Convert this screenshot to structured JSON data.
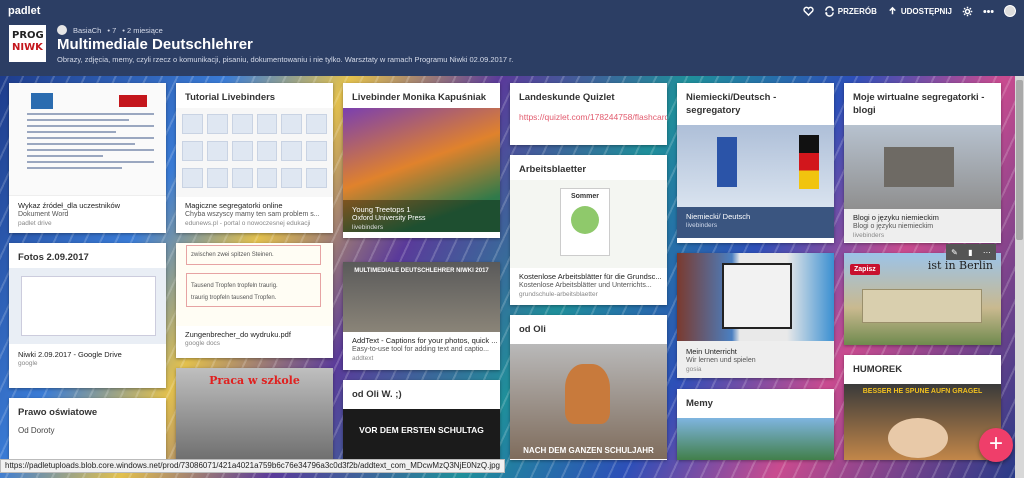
{
  "app": {
    "brand": "padlet"
  },
  "top_actions": {
    "remake": "PRZERÓB",
    "share": "UDOSTĘPNIJ"
  },
  "header": {
    "logo_line1": "PROG",
    "logo_line2": "NIWK",
    "author": "BasiaCh",
    "likes": "• 7",
    "age": "•   2 miesiące",
    "title": "Multimediale Deutschlehrer",
    "subtitle": "Obrazy, zdjęcia, memy, czyli rzecz o komunikacji, pisaniu, dokumentowaniu i nie tylko. Warsztaty w ramach Programu Niwki 02.09.2017 r."
  },
  "cards": {
    "c1": {
      "att_title": "Wykaz źródeł_dla uczestników",
      "att_sub": "Dokument Word",
      "att_src": "padlet drive"
    },
    "c2": {
      "title": "Fotos 2.09.2017",
      "att_title": "Niwki 2.09.2017 - Google Drive",
      "att_src": "google"
    },
    "c3": {
      "title": "Prawo oświatowe",
      "text": "Od Doroty"
    },
    "c4": {
      "title": "Tutorial Livebinders",
      "att_title": "Magiczne segregatorki online",
      "att_sub": "Chyba wszyscy mamy ten sam problem s...",
      "att_src": "edunews.pl - portal o nowoczesnej edukacji"
    },
    "c5": {
      "att_title": "Zungenbrecher_do wydruku.pdf",
      "att_src": "google docs",
      "thumb_line1": "zwischen zwei spitzen Steinen.",
      "thumb_line2": "Tausend Tropfen tropfeln traurig.",
      "thumb_line3": "traurig tropfeln tausend Tropfen."
    },
    "c6": {
      "thumb_text": "Praca w szkole"
    },
    "c7": {
      "title": "Livebinder Monika Kapuśniak",
      "att_title": "Young Treetops 1",
      "att_sub": "Oxford University Press",
      "att_src": "livebinders"
    },
    "c8": {
      "thumb_text": "MULTIMEDIALE DEUTSCHLEHRER NIWKI 2017",
      "att_title": "AddText - Captions for your photos, quick ...",
      "att_sub": "Easy-to-use tool for adding text and captio...",
      "att_src": "addtext"
    },
    "c9": {
      "title": "od Oli  W. ;)",
      "thumb_text": "VOR DEM ERSTEN SCHULTAG"
    },
    "c10": {
      "title": "Landeskunde Quizlet",
      "link": "https://quizlet.com/178244758/flashcards"
    },
    "c11": {
      "title": "Arbeitsblaetter",
      "thumb_text": "Sommer",
      "att_title": "Kostenlose Arbeitsblätter für die Grundsc...",
      "att_sub": "Kostenlose Arbeitsblätter und Unterrichts...",
      "att_src": "grundschule-arbeitsblaetter"
    },
    "c12": {
      "title": "od Oli",
      "thumb_text": "NACH DEM GANZEN SCHULJAHR"
    },
    "c13": {
      "title": "Niemiecki/Deutsch - segregatory",
      "att_title": "Niemiecki/ Deutsch",
      "att_src": "livebinders"
    },
    "c14": {
      "att_title": "Mein Unterricht",
      "att_sub": "Wir lernen und spielen",
      "att_src": "gosia"
    },
    "c15": {
      "title": "Memy"
    },
    "c16": {
      "title": "Moje wirtualne segregatorki - blogi",
      "att_title": "Blogi o języku niemieckim",
      "att_sub": "Blogi o języku niemieckim",
      "att_src": "livebinders"
    },
    "c17": {
      "zapisz": "Zapisz",
      "thumb_text": "ist in Berlin"
    },
    "c18": {
      "title": "HUMOREK",
      "thumb_text": "BESSER HE SPUNE AUFN GRAGEL"
    }
  },
  "status_url": "https://padletuploads.blob.core.windows.net/prod/73086071/421a4021a759b6c76e34796a3c0d3f2b/addtext_com_MDcwMzQ3NjE0NzQ.jpg",
  "fab_label": "+",
  "colors": {
    "accent": "#ef3e6a",
    "header": "#2c3e64",
    "link": "#e25b6e"
  }
}
